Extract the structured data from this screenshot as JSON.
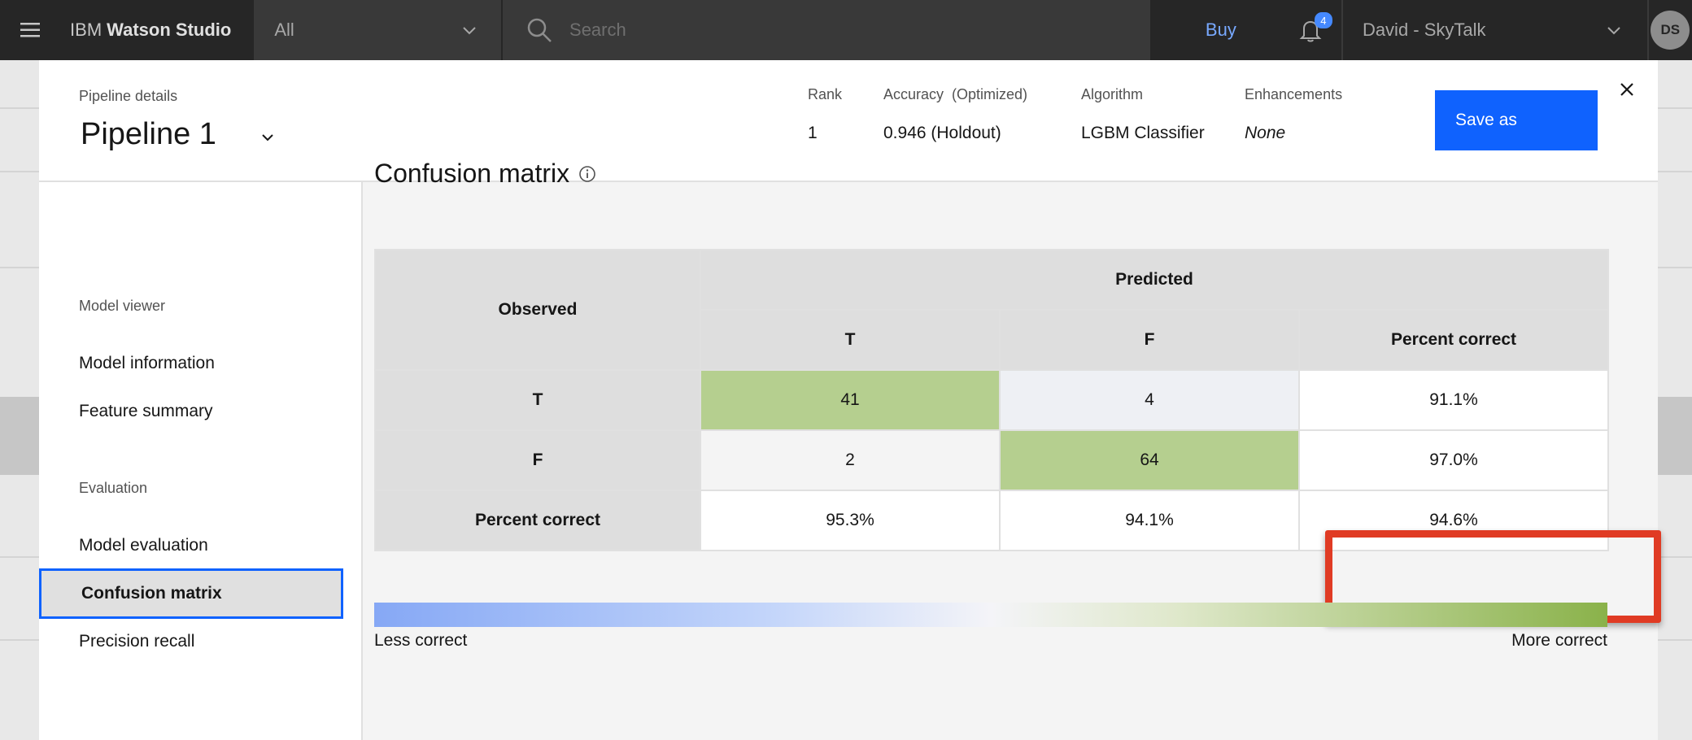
{
  "topbar": {
    "brand_prefix": "IBM",
    "brand_name": "Watson Studio",
    "scope": "All",
    "search_placeholder": "Search",
    "buy": "Buy",
    "notification_count": "4",
    "account": "David - SkyTalk",
    "avatar_initials": "DS"
  },
  "header": {
    "pipeline_label": "Pipeline details",
    "pipeline_title": "Pipeline 1",
    "rank_label": "Rank",
    "rank_value": "1",
    "accuracy_label": "Accuracy  (Optimized)",
    "accuracy_value": "0.946 (Holdout)",
    "algorithm_label": "Algorithm",
    "algorithm_value": "LGBM Classifier",
    "enhancements_label": "Enhancements",
    "enhancements_value": "None",
    "save_as": "Save as"
  },
  "nav": {
    "section_model_viewer": "Model viewer",
    "model_information": "Model information",
    "feature_summary": "Feature summary",
    "section_evaluation": "Evaluation",
    "model_evaluation": "Model evaluation",
    "confusion_matrix": "Confusion matrix",
    "precision_recall": "Precision recall"
  },
  "matrix": {
    "title": "Confusion matrix",
    "observed_header": "Observed",
    "predicted_header": "Predicted",
    "col_t": "T",
    "col_f": "F",
    "col_pct": "Percent correct",
    "rows": [
      {
        "label": "T",
        "t": "41",
        "f": "4",
        "pct": "91.1%"
      },
      {
        "label": "F",
        "t": "2",
        "f": "64",
        "pct": "97.0%"
      },
      {
        "label": "Percent correct",
        "t": "95.3%",
        "f": "94.1%",
        "pct": "94.6%"
      }
    ]
  },
  "legend": {
    "less": "Less correct",
    "more": "More correct",
    "color_low": "#86a8f5",
    "color_mid": "#f4f4f8",
    "color_high": "#8ab24a"
  },
  "colors": {
    "primary_button": "#0f62fe",
    "highlight": "#e03b24",
    "correct_cell": "#b5cf8f"
  }
}
